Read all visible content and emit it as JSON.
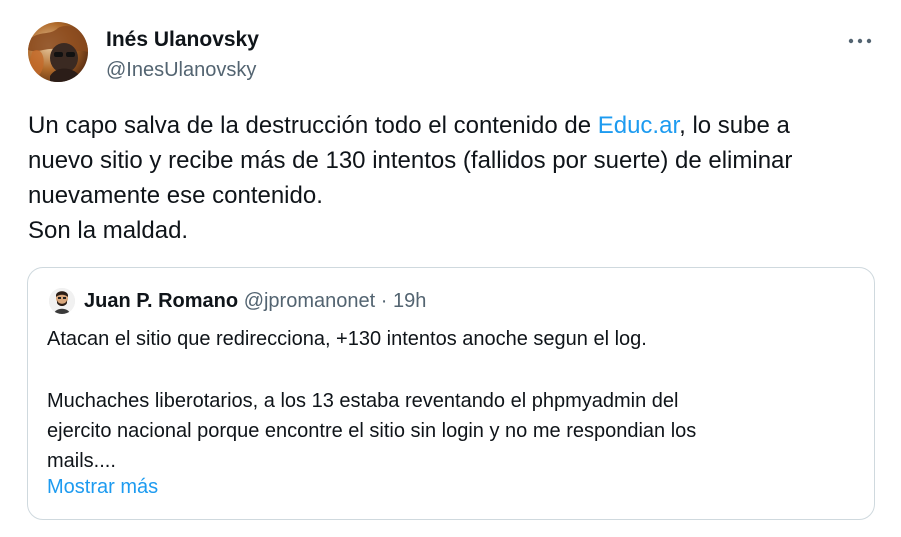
{
  "tweet": {
    "author": {
      "name": "Inés Ulanovsky",
      "handle": "@InesUlanovsky"
    },
    "more_icon": "more-horizontal-icon",
    "text_parts": {
      "line1_before": "Un capo salva de la destrucción todo el contenido de ",
      "line1_link": "Educ.ar",
      "line1_after": ", lo sube a",
      "line2": "nuevo sitio y recibe más de 130 intentos (fallidos por suerte) de eliminar",
      "line3": "nuevamente ese contenido.",
      "line4": "Son la maldad."
    }
  },
  "quote": {
    "author": {
      "name": "Juan P. Romano",
      "handle": "@jpromanonet",
      "separator": "·",
      "time": "19h"
    },
    "lines": [
      "Atacan el sitio que redirecciona, +130 intentos anoche segun el log.",
      "Muchaches liberotarios, a los 13 estaba reventando el phpmyadmin del",
      "ejercito nacional porque encontre el sitio sin login y no me respondian los",
      "mails...."
    ],
    "show_more": "Mostrar más"
  },
  "colors": {
    "text": "#0f1419",
    "secondary": "#536471",
    "link": "#1d9bf0",
    "border": "#cfd9de"
  }
}
